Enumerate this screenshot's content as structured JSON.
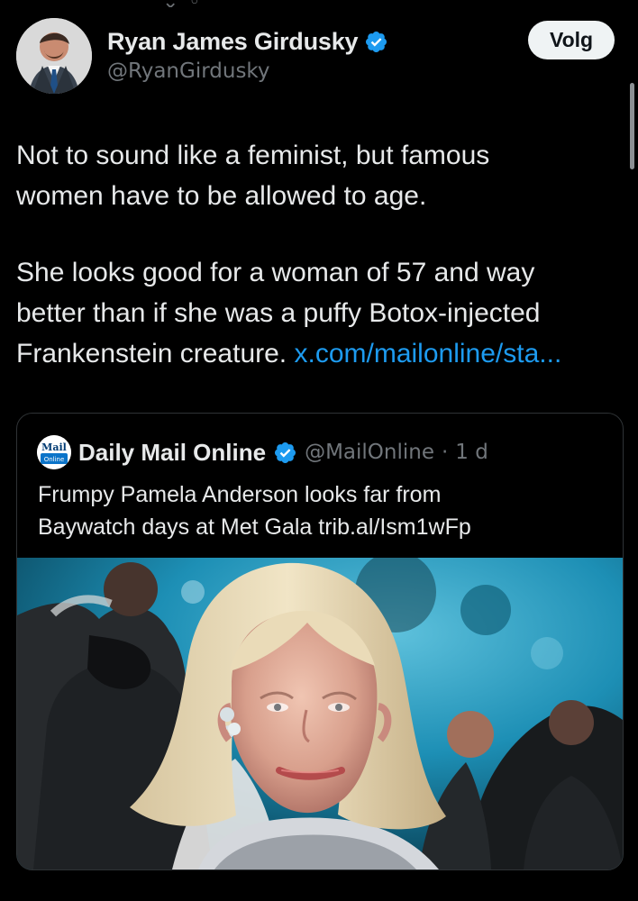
{
  "tweet": {
    "author": {
      "name": "Ryan James Girdusky",
      "handle": "@RyanGirdusky",
      "verified": true
    },
    "follow_label": "Volg",
    "text": {
      "line_1": "Not to sound like a feminist, but famous",
      "line_2": "women have to be allowed to age.",
      "line_3": "She looks good for a woman of 57 and way",
      "line_4": "better than if she was a puffy Botox-injected",
      "line_5_prefix": "Frankenstein creature.",
      "line_5_link": "x.com/mailonline/sta..."
    }
  },
  "quote": {
    "author": {
      "name": "Daily Mail Online",
      "handle": "@MailOnline",
      "separator": "·",
      "time": "1 d",
      "verified": true,
      "logo_text": "Mail Online"
    },
    "text": {
      "line_1": "Frumpy Pamela Anderson looks far from",
      "line_2": "Baywatch days at Met Gala trib.al/Ism1wFp"
    },
    "media": {
      "description_icon": "photo"
    }
  },
  "icons": {
    "verified": "verified-badge-icon",
    "logo": "mail-online-logo-icon",
    "scrollbar": "scrollbar-thumb"
  },
  "colors": {
    "background": "#000000",
    "text": "#e7e9ea",
    "secondary_text": "#71767b",
    "link": "#1d9bf0",
    "verified": "#1d9bf0",
    "follow_button": "#eff3f4"
  }
}
